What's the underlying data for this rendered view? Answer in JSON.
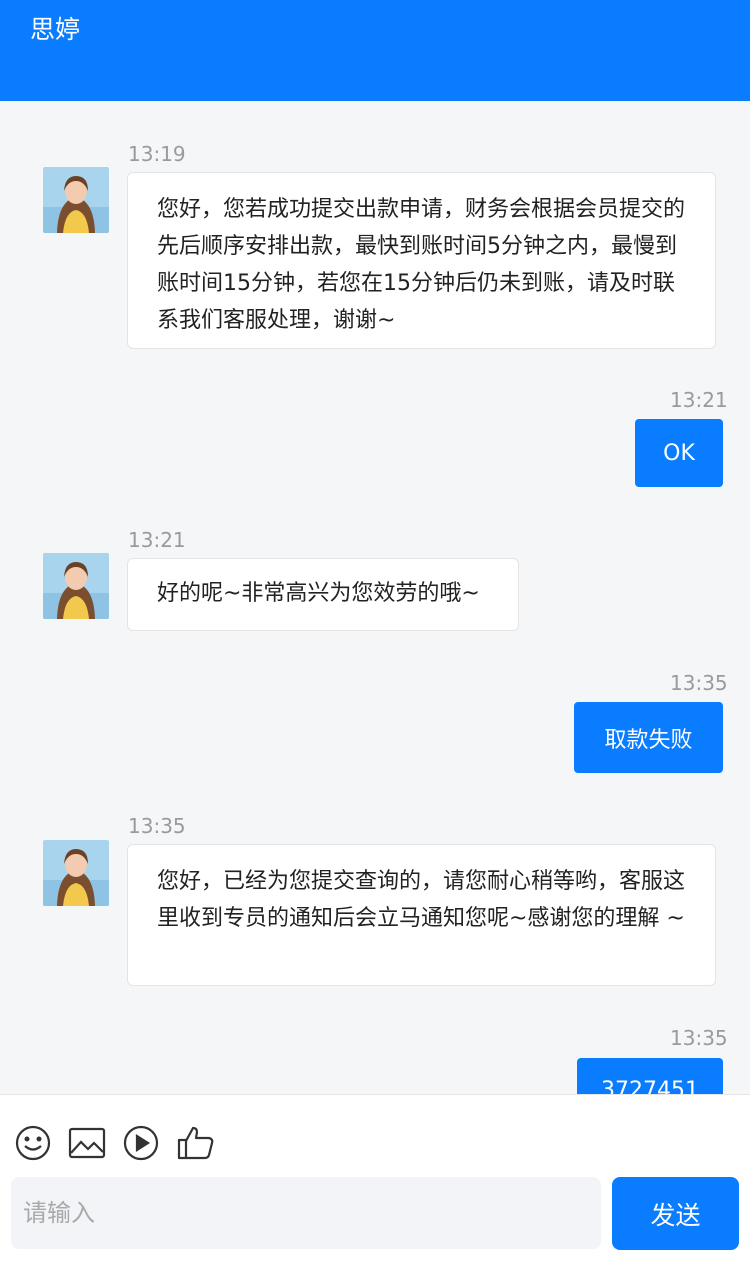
{
  "header": {
    "title": "思婷"
  },
  "messages": [
    {
      "direction": "in",
      "time": "13:19",
      "text": "您好，您若成功提交出款申请，财务会根据会员提交的先后顺序安排出款，最快到账时间5分钟之内，最慢到账时间15分钟，若您在15分钟后仍未到账，请及时联系我们客服处理，谢谢~"
    },
    {
      "direction": "out",
      "time": "13:21",
      "text": "OK"
    },
    {
      "direction": "in",
      "time": "13:21",
      "text": "好的呢~非常高兴为您效劳的哦~"
    },
    {
      "direction": "out",
      "time": "13:35",
      "text": "取款失败"
    },
    {
      "direction": "in",
      "time": "13:35",
      "text": "您好，已经为您提交查询的，请您耐心稍等哟，客服这里收到专员的通知后会立马通知您呢~感谢您的理解 ~"
    },
    {
      "direction": "out",
      "time": "13:35",
      "text": "3727451"
    }
  ],
  "toolbar": {
    "icons": [
      "emoji-icon",
      "image-icon",
      "video-icon",
      "thumbs-up-icon"
    ],
    "input_placeholder": "请输入",
    "input_value": "",
    "send_label": "发送"
  },
  "colors": {
    "accent": "#0a7cff",
    "background": "#f5f6f7",
    "bubble_in": "#ffffff"
  }
}
